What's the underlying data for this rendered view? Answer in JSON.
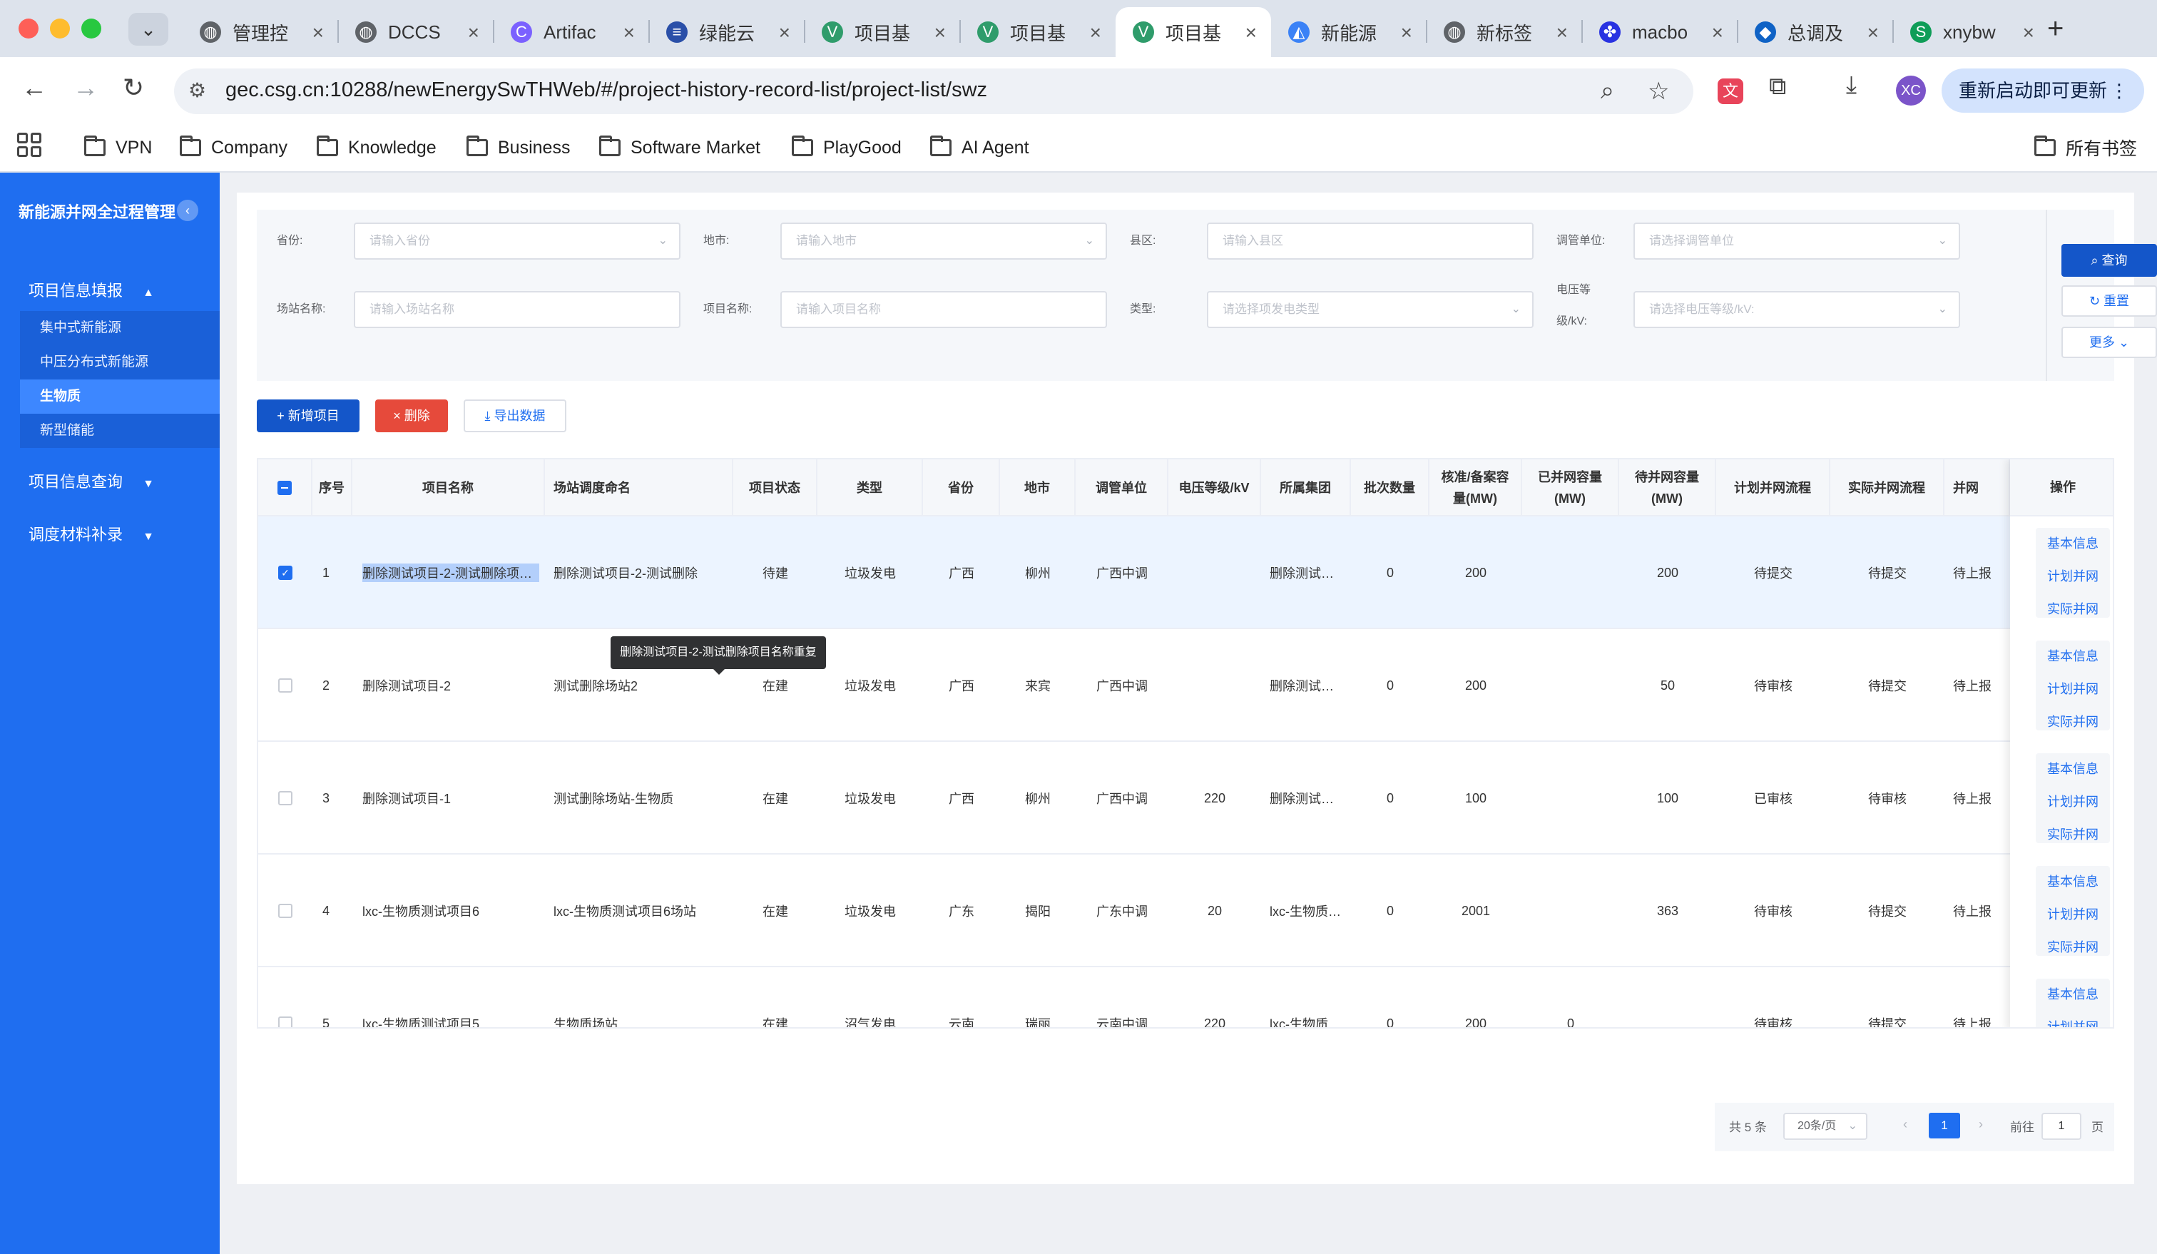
{
  "browser": {
    "tabs": [
      {
        "label": "管理控",
        "icon": "globe-icon",
        "color": "#5f6368"
      },
      {
        "label": "DCCS",
        "icon": "globe-icon",
        "color": "#5f6368"
      },
      {
        "label": "Artifac",
        "icon": "artifact-icon",
        "color": "#7b61ff"
      },
      {
        "label": "绿能云",
        "icon": "greencloud-icon",
        "color": "#2a4fa8"
      },
      {
        "label": "项目基",
        "icon": "vue-icon",
        "color": "#2f9c6b"
      },
      {
        "label": "项目基",
        "icon": "vue-icon",
        "color": "#2f9c6b"
      },
      {
        "label": "项目基",
        "icon": "vue-icon",
        "color": "#2f9c6b",
        "active": true
      },
      {
        "label": "新能源",
        "icon": "energy-icon",
        "color": "#3b82f6"
      },
      {
        "label": "新标签",
        "icon": "globe-icon",
        "color": "#5f6368"
      },
      {
        "label": "macbo",
        "icon": "baidu-icon",
        "color": "#2932e1"
      },
      {
        "label": "总调及",
        "icon": "azure-icon",
        "color": "#0f62c5"
      },
      {
        "label": "xnybw",
        "icon": "sheets-icon",
        "color": "#0f9d58"
      }
    ],
    "url": "gec.csg.cn:10288/newEnergySwTHWeb/#/project-history-record-list/project-list/swz",
    "update_label": "重新启动即可更新",
    "profile_initials": "XC",
    "bookmarks": [
      "VPN",
      "Company",
      "Knowledge",
      "Business",
      "Software Market",
      "PlayGood",
      "AI Agent"
    ],
    "all_bookmarks": "所有书签"
  },
  "sidebar": {
    "title": "新能源并网全过程管理",
    "collapse": "‹",
    "group1": {
      "label": "项目信息填报",
      "arrow": "▲"
    },
    "items": [
      "集中式新能源",
      "中压分布式新能源",
      "生物质",
      "新型储能"
    ],
    "group2": {
      "label": "项目信息查询",
      "arrow": "▼"
    },
    "group3": {
      "label": "调度材料补录",
      "arrow": "▼"
    }
  },
  "filters": {
    "province_label": "省份:",
    "province_ph": "请输入省份",
    "city_label": "地市:",
    "city_ph": "请输入地市",
    "county_label": "县区:",
    "county_ph": "请输入县区",
    "dispatch_label": "调管单位:",
    "dispatch_ph": "请选择调管单位",
    "station_label": "场站名称:",
    "station_ph": "请输入场站名称",
    "project_label": "项目名称:",
    "project_ph": "请输入项目名称",
    "type_label": "类型:",
    "type_ph": "请选择项发电类型",
    "voltage_label_1": "电压等",
    "voltage_label_2": "级/kV:",
    "voltage_ph": "请选择电压等级/kV:",
    "query_btn": "查询",
    "reset_btn": "重置",
    "more_btn": "更多"
  },
  "actions": {
    "add": "新增项目",
    "delete": "删除",
    "export": "导出数据"
  },
  "table": {
    "headers": {
      "idx": "序号",
      "project": "项目名称",
      "station": "场站调度命名",
      "status": "项目状态",
      "type": "类型",
      "province": "省份",
      "city": "地市",
      "dispatch": "调管单位",
      "voltage": "电压等级/kV",
      "group": "所属集团",
      "batch": "批次数量",
      "approved_1": "核准/备案容",
      "approved_2": "量(MW)",
      "connected_1": "已并网容量",
      "connected_2": "(MW)",
      "pending_1": "待并网容量",
      "pending_2": "(MW)",
      "plan_flow": "计划并网流程",
      "actual_flow": "实际并网流程",
      "grid": "并网",
      "ops": "操作"
    },
    "rows": [
      {
        "idx": "1",
        "project": "删除测试项目-2-测试删除项目名称重复",
        "station": "删除测试项目-2-测试删除",
        "status": "待建",
        "type": "垃圾发电",
        "province": "广西",
        "city": "柳州",
        "dispatch": "广西中调",
        "voltage": "",
        "group": "删除测试集团",
        "batch": "0",
        "approved": "200",
        "connected": "",
        "pending": "200",
        "plan_flow": "待提交",
        "actual_flow": "待提交",
        "grid": "待上报",
        "checked": true
      },
      {
        "idx": "2",
        "project": "删除测试项目-2",
        "station": "测试删除场站2",
        "status": "在建",
        "type": "垃圾发电",
        "province": "广西",
        "city": "来宾",
        "dispatch": "广西中调",
        "voltage": "",
        "group": "删除测试集团",
        "batch": "0",
        "approved": "200",
        "connected": "",
        "pending": "50",
        "plan_flow": "待审核",
        "actual_flow": "待提交",
        "grid": "待上报",
        "checked": false
      },
      {
        "idx": "3",
        "project": "删除测试项目-1",
        "station": "测试删除场站-生物质",
        "status": "在建",
        "type": "垃圾发电",
        "province": "广西",
        "city": "柳州",
        "dispatch": "广西中调",
        "voltage": "220",
        "group": "删除测试集团",
        "batch": "0",
        "approved": "100",
        "connected": "",
        "pending": "100",
        "plan_flow": "已审核",
        "actual_flow": "待审核",
        "grid": "待上报",
        "checked": false
      },
      {
        "idx": "4",
        "project": "lxc-生物质测试项目6",
        "station": "lxc-生物质测试项目6场站",
        "status": "在建",
        "type": "垃圾发电",
        "province": "广东",
        "city": "揭阳",
        "dispatch": "广东中调",
        "voltage": "20",
        "group": "lxc-生物质集团",
        "batch": "0",
        "approved": "2001",
        "connected": "",
        "pending": "363",
        "plan_flow": "待审核",
        "actual_flow": "待提交",
        "grid": "待上报",
        "checked": false
      },
      {
        "idx": "5",
        "project": "lxc-生物质测试项目5",
        "station": "生物质场站",
        "status": "在建",
        "type": "沼气发电",
        "province": "云南",
        "city": "瑞丽",
        "dispatch": "云南中调",
        "voltage": "220",
        "group": "lxc-生物质集团",
        "batch": "0",
        "approved": "200",
        "connected": "0",
        "pending": "",
        "plan_flow": "待审核",
        "actual_flow": "待提交",
        "grid": "待上报",
        "checked": false
      }
    ],
    "op_links": [
      "基本信息",
      "计划并网",
      "实际并网"
    ],
    "tooltip": "删除测试项目-2-测试删除项目名称重复"
  },
  "pagination": {
    "total": "共 5 条",
    "page_size": "20条/页",
    "current": "1",
    "goto_label": "前往",
    "goto_value": "1",
    "page_unit": "页"
  }
}
